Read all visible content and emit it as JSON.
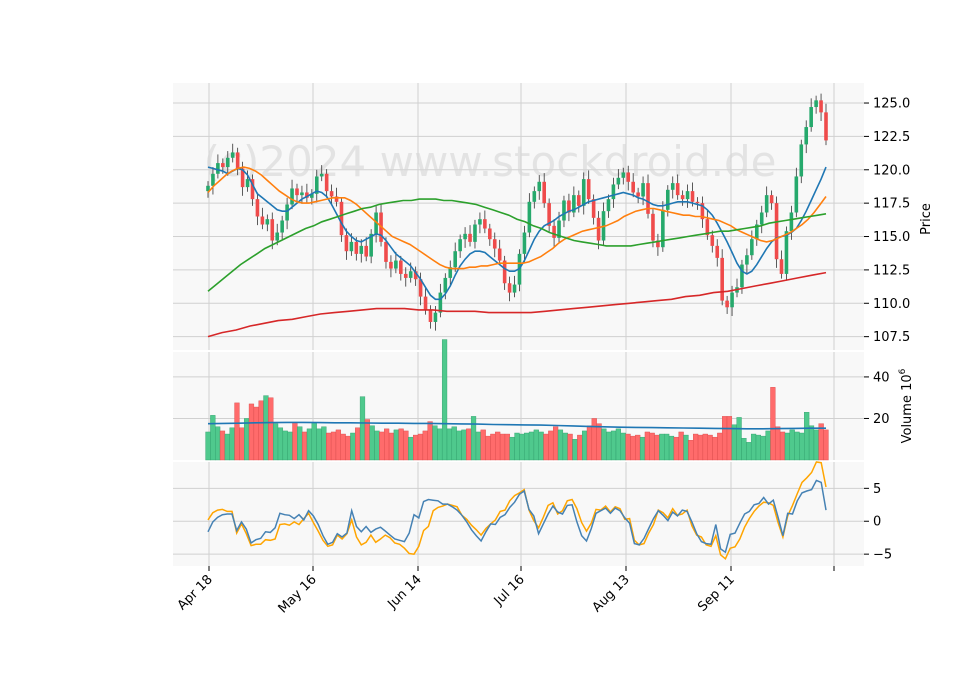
{
  "watermark": "(c)2024 www.stockdroid.de",
  "colors": {
    "up": "#26a96c",
    "down": "#ef4b4b",
    "vol_up": "#4fc98d",
    "vol_down": "#ff6b6b",
    "ma_fast": "#1f77b4",
    "ma_mid": "#ff7f0e",
    "ma_slow": "#2ca02c",
    "ma_long": "#d62728",
    "vol_ma": "#1f77b4",
    "osc_a": "#4682b4",
    "osc_b": "#ffa500",
    "panel_bg": "#f8f8f8",
    "grid": "#d0d0d0"
  },
  "x_tick_labels": [
    "Apr 18",
    "May 16",
    "Jun 14",
    "Jul 16",
    "Aug 13",
    "Sep 11"
  ],
  "price_panel": {
    "ylabel": "Price",
    "ylim": [
      106.5,
      126.5
    ],
    "ticks": [
      "107.5",
      "110.0",
      "112.5",
      "115.0",
      "117.5",
      "120.0",
      "122.5",
      "125.0"
    ]
  },
  "volume_panel": {
    "ylabel": "Volume  10",
    "ylabel_exp": "6",
    "ylim": [
      0,
      52
    ],
    "ticks": [
      "20",
      "40"
    ]
  },
  "osc_panel": {
    "ylim": [
      -6.8,
      9
    ],
    "ticks": [
      "−5",
      "0",
      "5"
    ]
  },
  "chart_data": {
    "type": "candlestick",
    "date_range": [
      "2024-04-18",
      "2024-09-25"
    ],
    "close": [
      118.8,
      119.7,
      120.5,
      120.2,
      120.9,
      121.3,
      120.1,
      118.7,
      119.3,
      117.8,
      116.5,
      115.9,
      116.3,
      114.7,
      115.3,
      116.2,
      117.4,
      118.6,
      118.1,
      118.3,
      117.9,
      118.2,
      119.5,
      119.7,
      118.4,
      118.0,
      117.6,
      115.1,
      113.9,
      114.6,
      113.7,
      114.3,
      113.5,
      115.2,
      116.8,
      114.6,
      113.1,
      112.6,
      113.2,
      112.2,
      111.9,
      112.4,
      111.8,
      110.5,
      109.5,
      108.6,
      109.3,
      110.8,
      111.9,
      112.7,
      113.9,
      114.8,
      115.2,
      114.6,
      115.9,
      116.3,
      115.6,
      114.8,
      114.1,
      113.2,
      111.5,
      110.8,
      111.4,
      113.7,
      115.3,
      117.6,
      118.4,
      119.1,
      117.5,
      115.8,
      114.9,
      116.2,
      117.7,
      116.8,
      118.1,
      117.3,
      119.3,
      117.8,
      116.4,
      114.7,
      116.9,
      117.8,
      118.9,
      119.4,
      119.8,
      119.1,
      118.3,
      118.0,
      119.0,
      116.7,
      114.7,
      114.2,
      117.0,
      118.5,
      119.0,
      118.1,
      117.8,
      118.4,
      117.6,
      117.5,
      116.3,
      115.1,
      114.3,
      113.4,
      110.2,
      109.7,
      110.8,
      111.2,
      112.9,
      113.6,
      114.8,
      115.9,
      116.8,
      118.1,
      117.5,
      113.3,
      112.2,
      115.4,
      116.8,
      119.5,
      121.9,
      123.2,
      124.7,
      125.2,
      124.3,
      122.2
    ],
    "volume_millions": [
      13.5,
      21.5,
      16.0,
      14.0,
      12.5,
      15.5,
      27.5,
      15.5,
      20.0,
      27.0,
      25.5,
      28.5,
      31.0,
      30.0,
      17.5,
      15.5,
      14.0,
      13.5,
      18.0,
      16.0,
      13.5,
      15.0,
      18.0,
      15.0,
      16.0,
      13.0,
      13.5,
      14.5,
      12.5,
      11.5,
      13.0,
      15.5,
      30.5,
      19.5,
      16.5,
      14.0,
      13.5,
      15.0,
      13.0,
      14.5,
      15.0,
      14.0,
      11.0,
      12.0,
      12.5,
      14.0,
      18.5,
      16.5,
      15.0,
      58.0,
      15.0,
      16.0,
      14.0,
      14.5,
      15.0,
      21.0,
      13.5,
      14.5,
      11.5,
      12.5,
      13.5,
      12.5,
      12.5,
      11.0,
      13.0,
      12.5,
      13.0,
      13.5,
      14.5,
      13.5,
      12.5,
      14.0,
      16.0,
      14.5,
      13.0,
      12.5,
      10.0,
      12.0,
      14.0,
      16.5,
      20.0,
      17.5,
      15.0,
      13.5,
      14.0,
      15.0,
      13.0,
      12.5,
      11.5,
      12.0,
      11.0,
      13.5,
      13.0,
      12.0,
      12.5,
      12.5,
      11.5,
      11.0,
      13.5,
      12.0,
      9.5,
      12.5,
      12.0,
      12.5,
      12.0,
      11.0,
      13.0,
      21.0,
      21.0,
      17.0,
      20.5,
      10.5,
      8.5,
      12.5,
      12.0,
      11.5,
      14.0,
      35.0,
      16.0,
      13.5,
      13.0,
      14.5,
      13.5,
      13.0,
      23.0,
      16.5,
      14.5,
      17.5,
      14.5
    ],
    "price_ma_series": [
      {
        "values": [
          120.2,
          120.1,
          120.0,
          119.9,
          119.7,
          119.9,
          120.1,
          120.0,
          119.6,
          118.9,
          118.2,
          117.9,
          117.6,
          117.3,
          117.0,
          116.9,
          116.9,
          117.2,
          117.5,
          117.8,
          118.0,
          118.2,
          118.4,
          118.3,
          118.0,
          117.4,
          116.7,
          116.0,
          115.4,
          115.0,
          114.7,
          114.6,
          114.8,
          115.0,
          115.2,
          115.1,
          114.7,
          114.2,
          113.7,
          113.4,
          113.1,
          112.8,
          112.3,
          111.8,
          111.2,
          110.6,
          110.3,
          110.3,
          110.7,
          111.3,
          112.1,
          112.8,
          113.3,
          113.7,
          113.9,
          113.9,
          113.8,
          113.5,
          113.2,
          112.9,
          112.6,
          112.4,
          112.4,
          112.6,
          113.2,
          114.0,
          114.8,
          115.4,
          115.8,
          116.0,
          116.2,
          116.5,
          116.7,
          116.9,
          117.0,
          117.2,
          117.4,
          117.6,
          117.7,
          117.8,
          117.9,
          118.0,
          118.1,
          118.2,
          118.3,
          118.2,
          118.1,
          117.9,
          117.8,
          117.6,
          117.4,
          117.3,
          117.3,
          117.4,
          117.5,
          117.6,
          117.6,
          117.6,
          117.5,
          117.4,
          117.3,
          117.0,
          116.6,
          116.0,
          115.3,
          114.6,
          113.8,
          113.0,
          112.4,
          112.2,
          112.4,
          112.9,
          113.5,
          114.1,
          114.6,
          114.9,
          115.0,
          115.1,
          115.3,
          115.6,
          116.2,
          116.9,
          117.7,
          118.5,
          119.3,
          120.2
        ]
      },
      {
        "values": [
          118.3,
          118.8,
          119.2,
          119.6,
          119.9,
          120.1,
          120.2,
          120.1,
          119.9,
          119.6,
          119.2,
          118.8,
          118.4,
          118.1,
          117.8,
          117.6,
          117.5,
          117.5,
          117.6,
          117.7,
          117.8,
          117.9,
          117.9,
          117.9,
          117.7,
          117.4,
          117.0,
          116.6,
          116.2,
          115.8,
          115.4,
          115.0,
          114.8,
          114.6,
          114.4,
          114.1,
          113.8,
          113.5,
          113.2,
          112.9,
          112.7,
          112.6,
          112.6,
          112.6,
          112.7,
          112.7,
          112.8,
          112.8,
          112.9,
          113.0,
          113.0,
          113.0,
          113.0,
          113.0,
          113.1,
          113.3,
          113.5,
          113.8,
          114.1,
          114.5,
          114.8,
          115.0,
          115.2,
          115.4,
          115.5,
          115.6,
          115.7,
          115.8,
          116.0,
          116.2,
          116.5,
          116.7,
          116.9,
          117.0,
          117.1,
          117.1,
          117.0,
          116.9,
          116.8,
          116.7,
          116.6,
          116.6,
          116.5,
          116.5,
          116.4,
          116.3,
          116.2,
          116.0,
          115.8,
          115.5,
          115.3,
          115.1,
          114.9,
          114.7,
          114.6,
          114.7,
          114.9,
          115.1,
          115.3,
          115.6,
          115.9,
          116.3,
          116.8,
          117.4,
          118.0
        ]
      },
      {
        "values": [
          110.9,
          111.4,
          111.9,
          112.4,
          112.9,
          113.3,
          113.7,
          114.1,
          114.4,
          114.7,
          115.0,
          115.3,
          115.6,
          115.8,
          116.1,
          116.3,
          116.5,
          116.7,
          116.9,
          117.1,
          117.2,
          117.4,
          117.5,
          117.6,
          117.7,
          117.7,
          117.8,
          117.8,
          117.8,
          117.7,
          117.7,
          117.6,
          117.5,
          117.4,
          117.2,
          117.0,
          116.8,
          116.6,
          116.3,
          116.1,
          115.8,
          115.6,
          115.3,
          115.1,
          114.9,
          114.7,
          114.6,
          114.5,
          114.4,
          114.3,
          114.3,
          114.3,
          114.3,
          114.4,
          114.5,
          114.6,
          114.7,
          114.8,
          114.9,
          115.0,
          115.1,
          115.2,
          115.3,
          115.4,
          115.4,
          115.5,
          115.6,
          115.7,
          115.8,
          116.0,
          116.1,
          116.2,
          116.3,
          116.4,
          116.5,
          116.6,
          116.7
        ]
      },
      {
        "values": [
          107.5,
          107.8,
          108.0,
          108.3,
          108.5,
          108.7,
          108.8,
          109.0,
          109.2,
          109.3,
          109.4,
          109.5,
          109.6,
          109.6,
          109.6,
          109.5,
          109.5,
          109.4,
          109.4,
          109.4,
          109.3,
          109.3,
          109.3,
          109.3,
          109.4,
          109.5,
          109.6,
          109.7,
          109.8,
          109.9,
          110.0,
          110.1,
          110.2,
          110.3,
          110.5,
          110.6,
          110.8,
          110.9,
          111.1,
          111.3,
          111.5,
          111.7,
          111.9,
          112.1,
          112.3
        ]
      }
    ],
    "volume_ma_millions": [
      17.5,
      17.6,
      17.7,
      17.9,
      18.0,
      18.1,
      18.1,
      18.0,
      17.9,
      17.9,
      17.8,
      17.7,
      17.7,
      17.6,
      17.6,
      17.5,
      17.4,
      17.3,
      17.1,
      17.0,
      16.9,
      16.8,
      16.6,
      16.4,
      16.2,
      16.0,
      15.8,
      15.7,
      15.6,
      15.5,
      15.4,
      15.3,
      15.2,
      15.1,
      15.0,
      15.0,
      15.1,
      15.2,
      15.3,
      15.3
    ],
    "osc_series": [
      {
        "values": [
          -1.6,
          -0.1,
          0.6,
          1.0,
          1.1,
          1.1,
          -1.4,
          -0.1,
          -1.2,
          -3.3,
          -2.8,
          -2.6,
          -1.6,
          -1.7,
          -1.0,
          1.2,
          1.0,
          0.9,
          0.4,
          1.0,
          0.2,
          1.6,
          0.8,
          -0.5,
          -2.2,
          -3.5,
          -3.2,
          -1.9,
          -2.4,
          -1.8,
          1.6,
          -0.8,
          -1.6,
          -0.8,
          -1.7,
          -1.2,
          -0.9,
          -1.5,
          -2.1,
          -2.7,
          -2.9,
          -3.1,
          -1.8,
          1.0,
          0.5,
          3.0,
          3.3,
          3.2,
          3.1,
          2.6,
          2.6,
          2.2,
          1.7,
          0.9,
          -0.1,
          -1.3,
          -2.2,
          -3.0,
          -1.6,
          -0.4,
          -0.5,
          0.6,
          1.0,
          2.1,
          2.9,
          4.1,
          4.6,
          1.8,
          0.8,
          -1.9,
          -0.4,
          1.1,
          2.3,
          1.4,
          1.1,
          2.4,
          2.5,
          -0.1,
          -2.2,
          -3.0,
          -1.1,
          1.2,
          1.6,
          2.0,
          1.2,
          2.0,
          1.6,
          0.5,
          -0.3,
          -3.4,
          -3.6,
          -2.6,
          -1.1,
          0.4,
          1.6,
          0.9,
          0.1,
          1.4,
          0.8,
          1.7,
          1.5,
          -0.1,
          -1.9,
          -3.1,
          -3.4,
          -3.5,
          -0.5,
          -4.2,
          -4.7,
          -2.0,
          -1.8,
          -0.3,
          1.1,
          1.5,
          2.5,
          2.7,
          3.6,
          2.6,
          3.2,
          0.6,
          -2.2,
          1.2,
          1.1,
          3.1,
          4.3,
          4.6,
          4.8,
          6.2,
          5.9,
          1.7
        ]
      },
      {
        "values": [
          0.2,
          1.3,
          1.7,
          1.8,
          1.5,
          1.5,
          -1.8,
          -0.4,
          -1.9,
          -3.7,
          -3.5,
          -3.5,
          -2.8,
          -2.9,
          -2.7,
          -0.5,
          -0.4,
          -0.6,
          -0.1,
          -0.5,
          0.4,
          1.2,
          -0.2,
          -1.5,
          -2.9,
          -3.8,
          -3.6,
          -2.1,
          -2.7,
          -1.9,
          0.2,
          -2.4,
          -3.6,
          -3.2,
          -2.1,
          -3.2,
          -2.7,
          -2.1,
          -2.5,
          -3.3,
          -3.5,
          -4.1,
          -4.9,
          -5.0,
          -3.8,
          -1.4,
          -0.8,
          1.6,
          2.1,
          2.3,
          2.6,
          2.4,
          2.2,
          0.9,
          0.3,
          -0.6,
          -1.3,
          -2.1,
          -1.1,
          -0.4,
          0.2,
          1.5,
          1.7,
          3.1,
          3.9,
          4.3,
          4.8,
          1.7,
          0.1,
          -1.0,
          0.6,
          2.4,
          2.8,
          1.1,
          1.6,
          3.1,
          3.3,
          1.9,
          -0.2,
          -1.5,
          -0.3,
          1.8,
          1.7,
          2.3,
          1.4,
          2.2,
          1.9,
          0.3,
          0.4,
          -2.9,
          -3.6,
          -3.4,
          -1.8,
          -0.5,
          1.7,
          1.3,
          0.5,
          1.9,
          0.9,
          1.1,
          1.7,
          -0.7,
          -2.1,
          -2.4,
          -3.6,
          -3.8,
          -2.2,
          -5.1,
          -5.7,
          -4.1,
          -3.9,
          -2.7,
          -0.9,
          0.4,
          1.5,
          2.3,
          2.9,
          2.8,
          2.4,
          -0.2,
          -2.4,
          0.8,
          2.4,
          4.2,
          5.9,
          6.6,
          7.4,
          9.0,
          8.9,
          5.2
        ]
      }
    ]
  }
}
